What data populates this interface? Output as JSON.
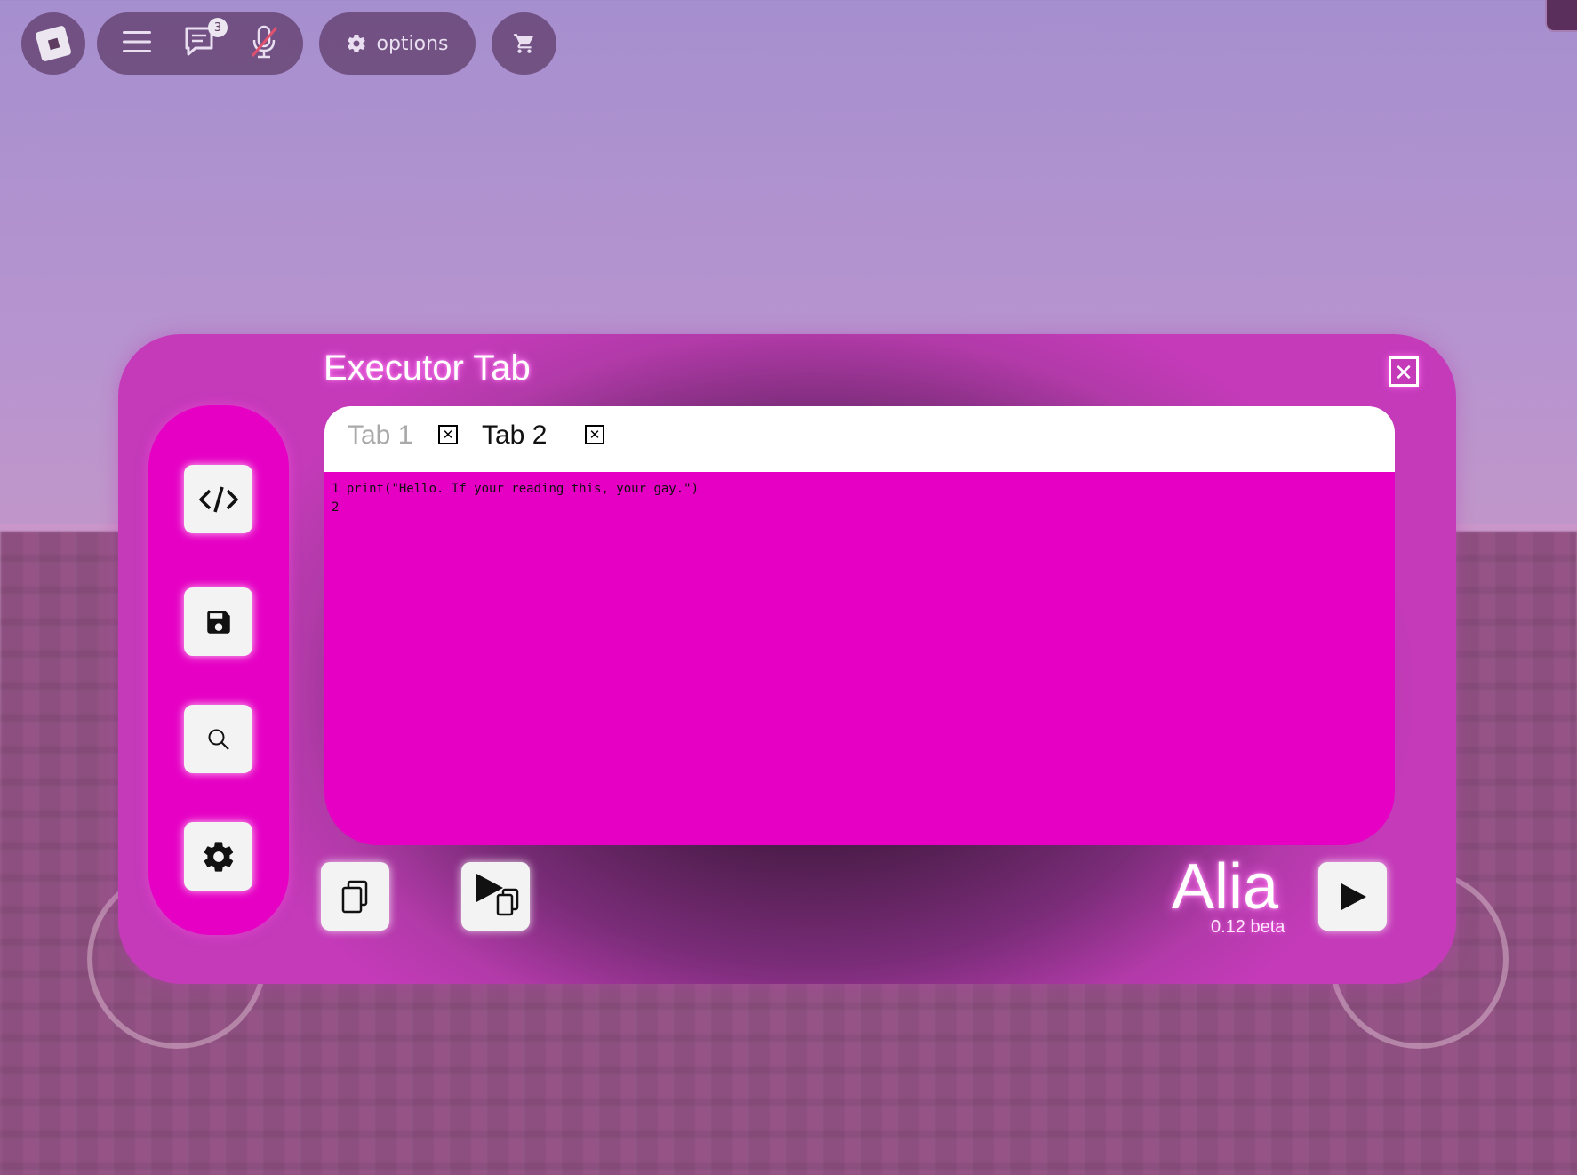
{
  "topbar": {
    "chat_badge_count": "3",
    "options_label": "options"
  },
  "executor": {
    "title": "Executor Tab",
    "tabs": [
      {
        "label": "Tab 1",
        "active": false
      },
      {
        "label": "Tab 2",
        "active": true
      }
    ],
    "code_lines": [
      {
        "number": "1",
        "text": "print(\"Hello. If your reading this, your gay.\")"
      },
      {
        "number": "2",
        "text": ""
      }
    ],
    "sidebar_icons": [
      "code-icon",
      "save-icon",
      "search-icon",
      "gear-icon"
    ],
    "brand_name": "Alia",
    "version": "0.12 beta"
  },
  "colors": {
    "accent_pink": "#e600c4",
    "tab_bar": "#ffffff",
    "window_edge": "#c43ab9",
    "window_center": "#2e1530"
  }
}
